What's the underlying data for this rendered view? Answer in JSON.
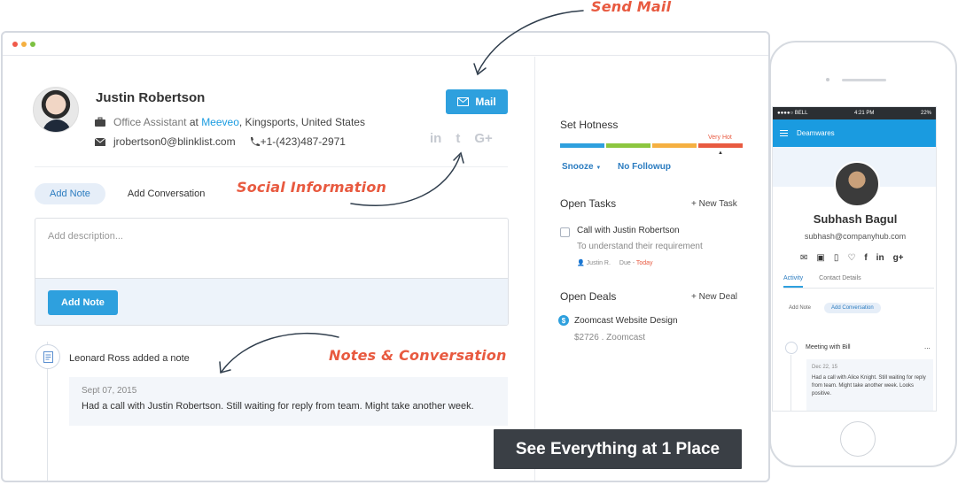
{
  "callouts": {
    "send_mail": "Send Mail",
    "social": "Social Information",
    "notes": "Notes & Conversation"
  },
  "contact": {
    "name": "Justin Robertson",
    "role": "Office Assistant",
    "at": "at",
    "company": "Meeveo",
    "location": ", Kingsports, United States",
    "email": "jrobertson0@blinklist.com",
    "phone": "+1-(423)487-2971",
    "mail_button": "Mail",
    "socials": [
      "in",
      "t",
      "G+"
    ]
  },
  "tabs": {
    "add_note": "Add Note",
    "add_conversation": "Add Conversation"
  },
  "editor": {
    "placeholder": "Add description...",
    "submit": "Add Note"
  },
  "timeline": {
    "title": "Leonard Ross added a note",
    "date": "Sept 07, 2015",
    "text": "Had a call with Justin Robertson. Still waiting for reply from team. Might take another week."
  },
  "sidebar": {
    "hotness_title": "Set Hotness",
    "very_hot": "Very Hot",
    "hotness_colors": [
      "#2ea0de",
      "#8cc63f",
      "#f5b041",
      "#e85a40"
    ],
    "snooze": "Snooze",
    "no_followup": "No Followup",
    "tasks_title": "Open Tasks",
    "new_task": "New Task",
    "task_title": "Call with Justin Robertson",
    "task_sub": "To understand their requirement",
    "task_owner": "Justin R.",
    "task_due_label": "Due -",
    "task_due": "Today",
    "deals_title": "Open Deals",
    "new_deal": "New Deal",
    "deal_title": "Zoomcast Website Design",
    "deal_sub": "$2726 . Zoomcast"
  },
  "banner": "See Everything at 1 Place",
  "phone": {
    "carrier": "●●●●○ BELL",
    "time": "4:21 PM",
    "battery": "22%",
    "app_title": "Deamwares",
    "name": "Subhash Bagul",
    "email": "subhash@companyhub.com",
    "tab_activity": "Activity",
    "tab_details": "Contact Details",
    "add_note": "Add Note",
    "add_conversation": "Add Conversation",
    "meeting": "Meeting with Bill",
    "dots": "...",
    "card_date": "Dec 22, 15",
    "card_text": "Had a call with Alice Knight. Still waiting for reply from team. Might take another week. Looks positive."
  }
}
